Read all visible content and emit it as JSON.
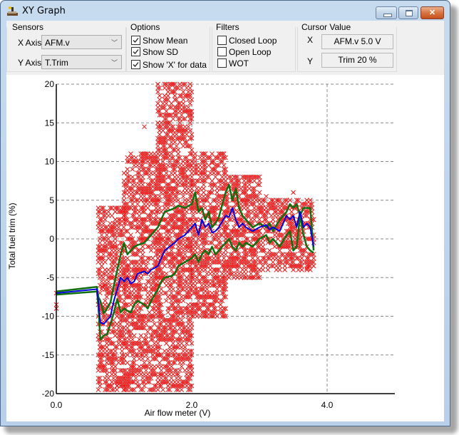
{
  "window": {
    "title": "XY Graph",
    "icon": "car-lift-icon",
    "buttons": [
      "minimize",
      "maximize",
      "close"
    ]
  },
  "sensors": {
    "group_label": "Sensors",
    "x_axis_label": "X Axis",
    "x_axis_value": "AFM.v",
    "y_axis_label": "Y Axis",
    "y_axis_value": "T.Trim"
  },
  "options": {
    "group_label": "Options",
    "items": [
      {
        "label": "Show Mean",
        "checked": true
      },
      {
        "label": "Show SD",
        "checked": true
      },
      {
        "label": "Show 'X' for data",
        "checked": true
      }
    ]
  },
  "filters": {
    "group_label": "Filters",
    "items": [
      {
        "label": "Closed Loop",
        "checked": false
      },
      {
        "label": "Open Loop",
        "checked": false
      },
      {
        "label": "WOT",
        "checked": false
      }
    ]
  },
  "cursor": {
    "group_label": "Cursor Value",
    "x_label": "X",
    "x_value": "AFM.v 5.0 V",
    "y_label": "Y",
    "y_value": "Trim 20 %"
  },
  "colors": {
    "scatter": "#ee1111",
    "mean": "#0000dd",
    "sd": "#107010",
    "grid": "#888888"
  },
  "chart_data": {
    "type": "scatter",
    "title": "",
    "xlabel": "Air flow meter (V)",
    "ylabel": "Total fuel trim (%)",
    "xlim": [
      0,
      5.0
    ],
    "ylim": [
      -20,
      20
    ],
    "x_ticks": [
      0.0,
      2.0,
      4.0
    ],
    "x_tick_labels": [
      "0.0",
      "2.0",
      "4.0"
    ],
    "y_ticks": [
      20,
      15,
      10,
      5,
      0,
      -5,
      -10,
      -15,
      -20
    ],
    "y_tick_labels": [
      "20",
      "15",
      "10",
      "5",
      "0",
      "-5",
      "-10",
      "-15",
      "-20"
    ],
    "grid": true,
    "scatter_marker": "x",
    "scatter_density": [
      {
        "x_from": 0.62,
        "x_to": 1.0,
        "y_from": -19.5,
        "y_to": 4
      },
      {
        "x_from": 1.0,
        "x_to": 1.5,
        "y_from": -19.5,
        "y_to": 11
      },
      {
        "x_from": 1.5,
        "x_to": 2.0,
        "y_from": -19.5,
        "y_to": 20
      },
      {
        "x_from": 2.0,
        "x_to": 2.5,
        "y_from": -10,
        "y_to": 11
      },
      {
        "x_from": 2.5,
        "x_to": 3.0,
        "y_from": -5,
        "y_to": 8
      },
      {
        "x_from": 3.0,
        "x_to": 3.8,
        "y_from": -4,
        "y_to": 5
      }
    ],
    "series": [
      {
        "name": "Mean",
        "x": [
          0.0,
          0.6,
          0.62,
          0.65,
          0.7,
          0.75,
          0.8,
          0.85,
          0.9,
          0.95,
          1.0,
          1.05,
          1.1,
          1.15,
          1.2,
          1.3,
          1.35,
          1.4,
          1.5,
          1.55,
          1.6,
          1.7,
          1.75,
          1.8,
          1.9,
          2.0,
          2.05,
          2.1,
          2.15,
          2.2,
          2.25,
          2.3,
          2.35,
          2.4,
          2.5,
          2.55,
          2.6,
          2.65,
          2.7,
          2.75,
          2.8,
          2.9,
          3.0,
          3.1,
          3.15,
          3.2,
          3.3,
          3.4,
          3.45,
          3.5,
          3.55,
          3.6,
          3.65,
          3.7,
          3.75,
          3.8
        ],
        "y": [
          -7.0,
          -6.5,
          -8.0,
          -10.8,
          -11.0,
          -10.5,
          -10.0,
          -8.0,
          -6.5,
          -5.0,
          -5.5,
          -5.0,
          -5.8,
          -5.5,
          -4.5,
          -4.2,
          -4.5,
          -4.0,
          -3.5,
          -2.5,
          -1.5,
          -0.8,
          -0.5,
          0.0,
          0.5,
          1.5,
          2.0,
          0.5,
          2.5,
          1.5,
          2.0,
          0.8,
          1.0,
          1.5,
          3.0,
          2.8,
          4.0,
          2.5,
          1.5,
          2.0,
          1.5,
          1.0,
          1.5,
          1.8,
          1.2,
          1.5,
          1.0,
          3.0,
          2.5,
          3.0,
          1.5,
          3.5,
          1.5,
          2.0,
          1.5,
          -1.0
        ]
      },
      {
        "name": "Mean + SD",
        "x": [
          0.0,
          0.6,
          0.62,
          0.65,
          0.7,
          0.75,
          0.8,
          0.85,
          0.9,
          0.95,
          1.0,
          1.05,
          1.1,
          1.15,
          1.2,
          1.3,
          1.35,
          1.4,
          1.5,
          1.55,
          1.6,
          1.7,
          1.75,
          1.8,
          1.9,
          2.0,
          2.05,
          2.1,
          2.15,
          2.2,
          2.25,
          2.3,
          2.35,
          2.4,
          2.5,
          2.55,
          2.6,
          2.65,
          2.7,
          2.75,
          2.8,
          2.9,
          3.0,
          3.1,
          3.15,
          3.2,
          3.3,
          3.4,
          3.45,
          3.5,
          3.55,
          3.6,
          3.65,
          3.7,
          3.75,
          3.8
        ],
        "y": [
          -6.8,
          -6.2,
          -7.5,
          -8.0,
          -9.6,
          -9.0,
          -8.2,
          -6.0,
          -4.0,
          -2.0,
          -0.5,
          -2.0,
          -1.5,
          -1.0,
          -0.8,
          -0.5,
          0.0,
          0.5,
          1.5,
          2.5,
          3.5,
          3.8,
          4.0,
          4.3,
          4.0,
          4.5,
          6.0,
          3.5,
          4.0,
          2.5,
          3.5,
          1.5,
          2.0,
          2.8,
          6.0,
          7.0,
          5.0,
          6.5,
          4.0,
          3.0,
          2.5,
          1.5,
          2.0,
          1.5,
          2.0,
          1.0,
          2.5,
          3.5,
          4.5,
          4.0,
          4.5,
          3.0,
          4.0,
          4.0,
          4.0,
          -1.5
        ]
      },
      {
        "name": "Mean - SD",
        "x": [
          0.0,
          0.6,
          0.62,
          0.65,
          0.7,
          0.75,
          0.8,
          0.85,
          0.9,
          0.95,
          1.0,
          1.05,
          1.1,
          1.15,
          1.2,
          1.3,
          1.35,
          1.4,
          1.5,
          1.55,
          1.6,
          1.7,
          1.75,
          1.8,
          1.9,
          2.0,
          2.05,
          2.1,
          2.15,
          2.2,
          2.25,
          2.3,
          2.35,
          2.4,
          2.5,
          2.55,
          2.6,
          2.65,
          2.7,
          2.75,
          2.8,
          2.9,
          3.0,
          3.1,
          3.15,
          3.2,
          3.3,
          3.4,
          3.45,
          3.5,
          3.55,
          3.6,
          3.65,
          3.7,
          3.75,
          3.8
        ],
        "y": [
          -7.2,
          -6.8,
          -8.5,
          -13.0,
          -12.5,
          -12.3,
          -11.0,
          -9.5,
          -7.8,
          -9.5,
          -9.0,
          -9.3,
          -9.5,
          -8.5,
          -8.0,
          -8.5,
          -9.0,
          -8.0,
          -6.5,
          -5.5,
          -5.0,
          -4.8,
          -4.5,
          -3.5,
          -3.0,
          -2.5,
          -2.0,
          -3.0,
          -2.0,
          -1.5,
          -2.0,
          -1.0,
          -2.0,
          -1.5,
          -0.5,
          0.0,
          -1.0,
          -1.5,
          -0.5,
          -1.0,
          -0.5,
          -1.0,
          0.0,
          0.5,
          -0.5,
          0.0,
          -1.0,
          0.5,
          1.0,
          -1.5,
          -1.0,
          3.0,
          0.5,
          -1.0,
          -1.5,
          -1.8
        ]
      }
    ]
  }
}
